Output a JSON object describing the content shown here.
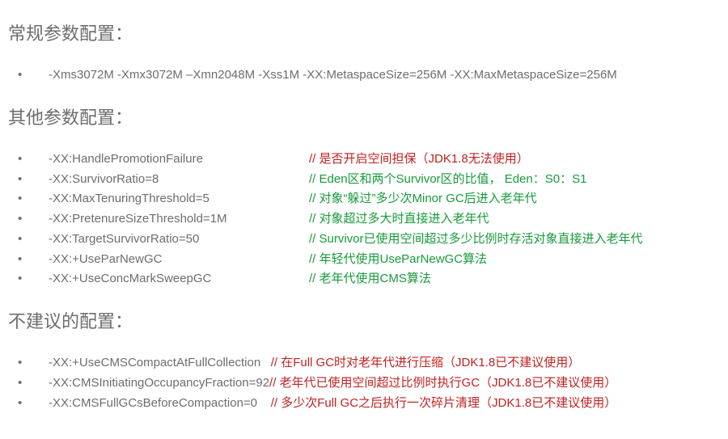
{
  "section1": {
    "title": "常规参数配置：",
    "items": [
      {
        "param": "-Xms3072M -Xmx3072M –Xmn2048M -Xss1M -XX:MetaspaceSize=256M -XX:MaxMetaspaceSize=256M"
      }
    ]
  },
  "section2": {
    "title": "其他参数配置：",
    "items": [
      {
        "param": "-XX:HandlePromotionFailure",
        "comment": "// 是否开启空间担保（JDK1.8无法使用）",
        "color": "red"
      },
      {
        "param": "-XX:SurvivorRatio=8",
        "comment": "// Eden区和两个Survivor区的比值， Eden：S0：S1",
        "color": "green"
      },
      {
        "param": "-XX:MaxTenuringThreshold=5",
        "comment": "// 对象“躲过”多少次Minor GC后进入老年代",
        "color": "green"
      },
      {
        "param": "-XX:PretenureSizeThreshold=1M",
        "comment": "// 对象超过多大时直接进入老年代",
        "color": "green"
      },
      {
        "param": "-XX:TargetSurvivorRatio=50",
        "comment": "// Survivor已使用空间超过多少比例时存活对象直接进入老年代",
        "color": "green"
      },
      {
        "param": "-XX:+UseParNewGC",
        "comment": "// 年轻代使用UseParNewGC算法",
        "color": "green"
      },
      {
        "param": "-XX:+UseConcMarkSweepGC",
        "comment": "// 老年代使用CMS算法",
        "color": "green"
      }
    ]
  },
  "section3": {
    "title": "不建议的配置：",
    "items": [
      {
        "param": "-XX:+UseCMSCompactAtFullCollection   ",
        "comment": "// 在Full GC时对老年代进行压缩（JDK1.8已不建议使用）",
        "color": "red"
      },
      {
        "param": "-XX:CMSInitiatingOccupancyFraction=92",
        "comment": "// 老年代已使用空间超过比例时执行GC（JDK1.8已不建议使用）",
        "color": "red"
      },
      {
        "param": "-XX:CMSFullGCsBeforeCompaction=0    ",
        "comment": "// 多少次Full GC之后执行一次碎片清理（JDK1.8已不建议使用）",
        "color": "red"
      }
    ]
  }
}
